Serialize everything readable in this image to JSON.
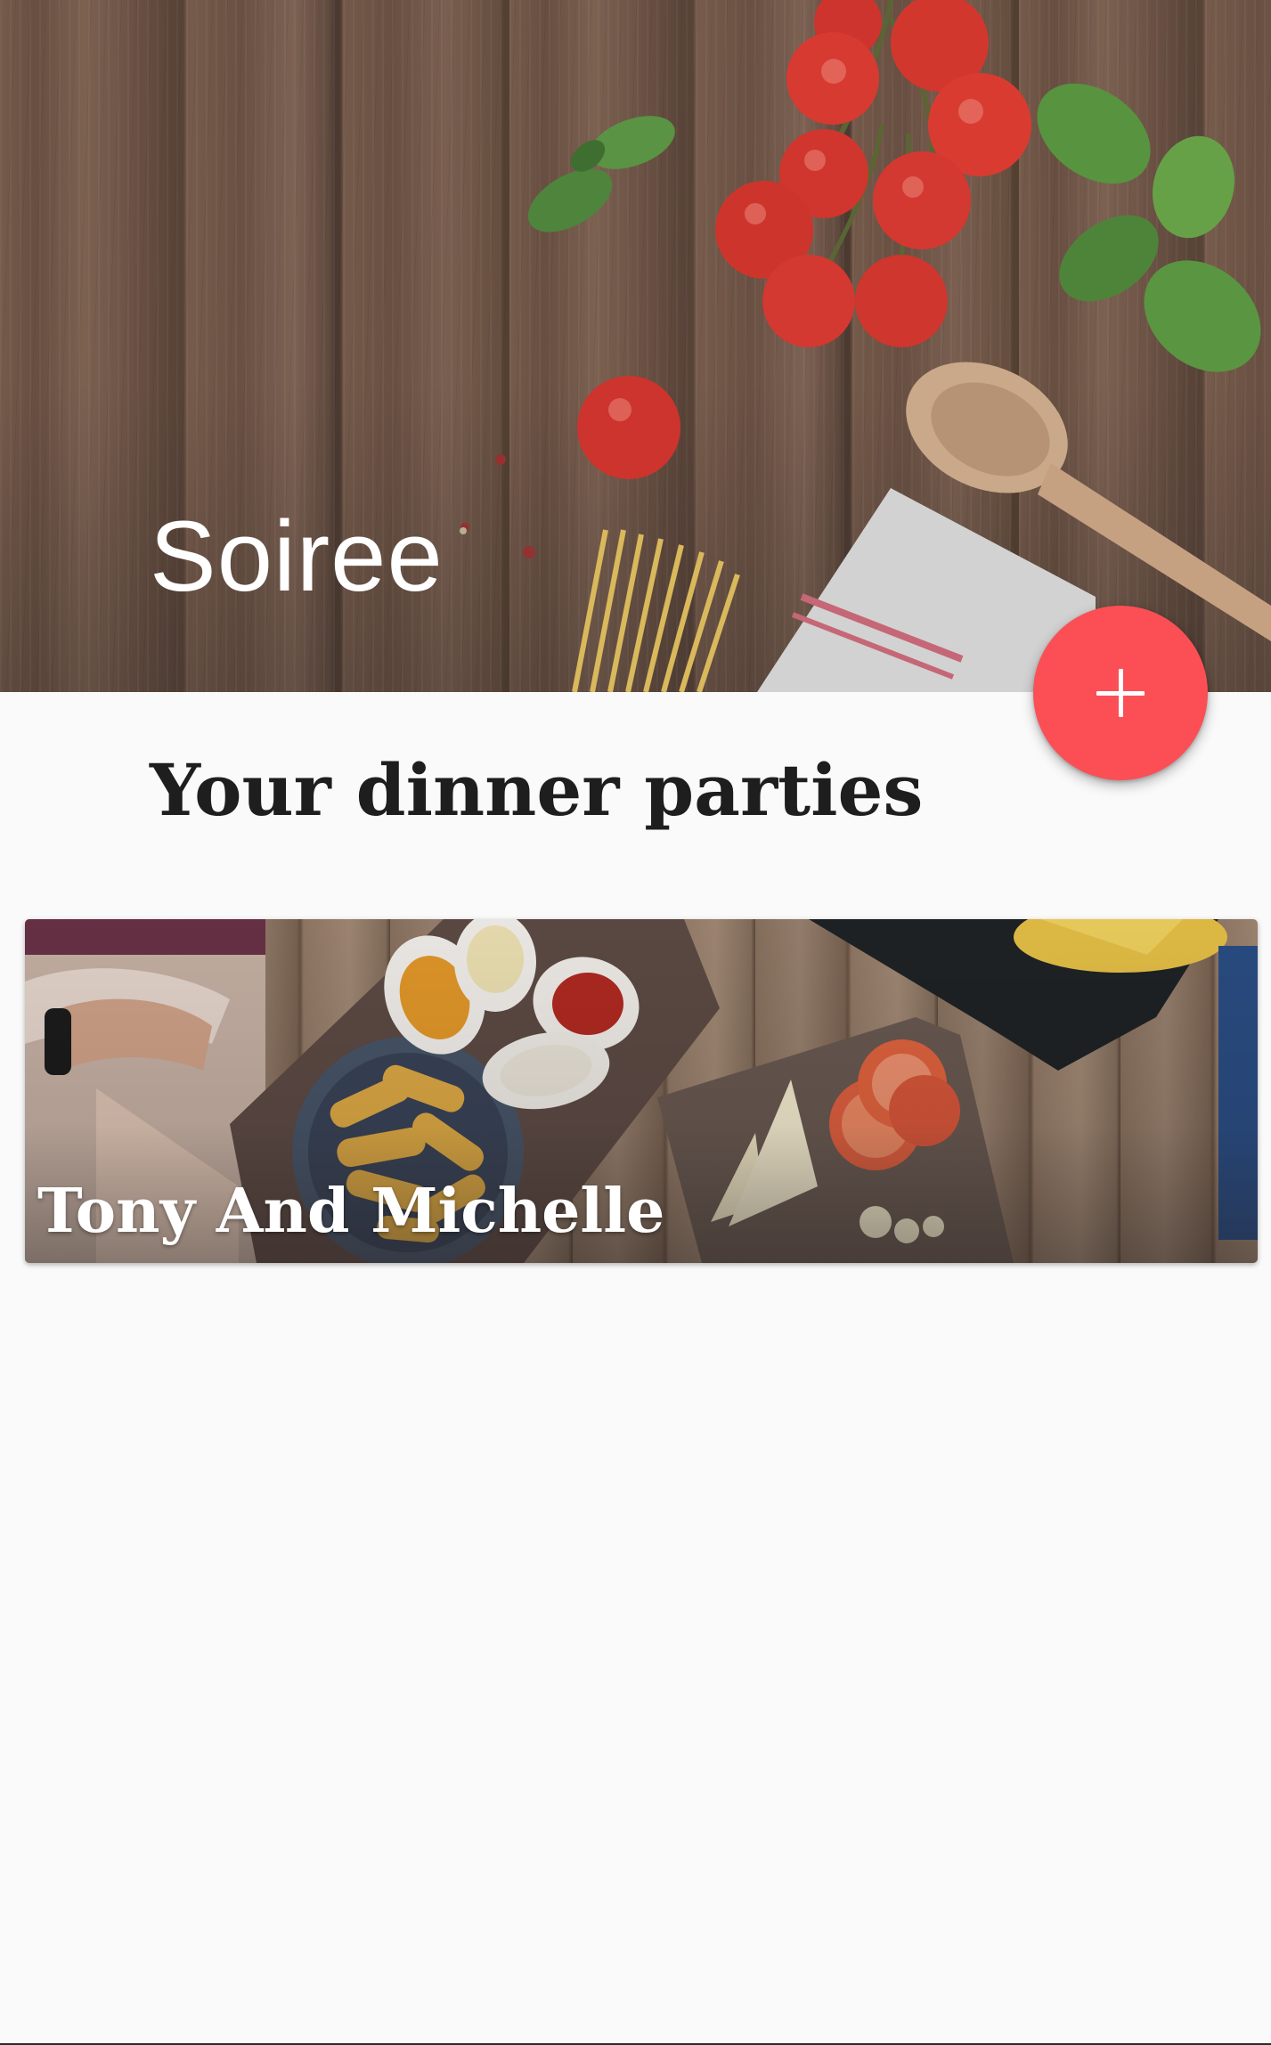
{
  "app": {
    "title": "Soiree",
    "accent_color": "#fb4f55"
  },
  "header": {
    "background": "wood-table-with-tomatoes-basil-spoon-pasta",
    "icon": "header-image"
  },
  "fab": {
    "icon": "plus-icon",
    "color": "#fb4f55"
  },
  "section": {
    "heading": "Your dinner parties"
  },
  "parties": [
    {
      "name": "Tony And Michelle",
      "image": "food-platter-fries-dips-tomatoes"
    }
  ]
}
